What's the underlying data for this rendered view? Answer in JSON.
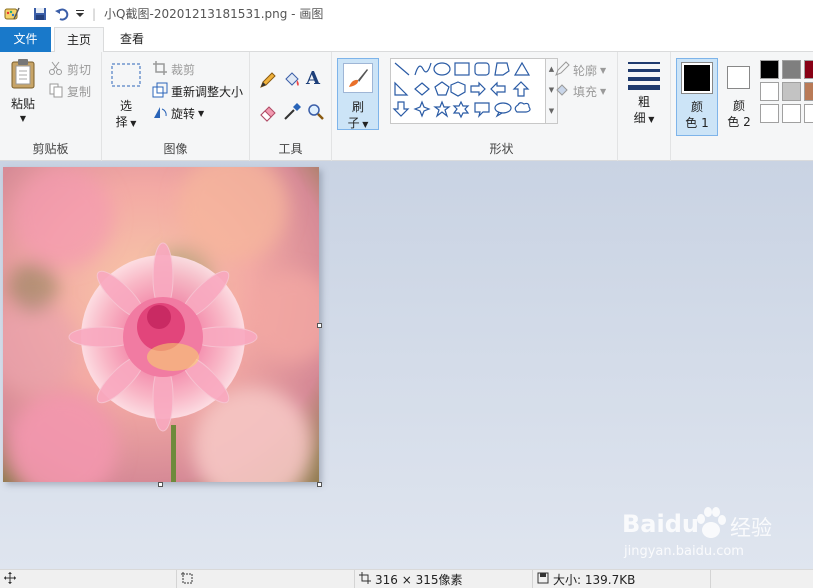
{
  "window": {
    "title": "小Q截图-20201213181531.png - 画图"
  },
  "tabs": [
    {
      "label": "文件"
    },
    {
      "label": "主页"
    },
    {
      "label": "查看"
    }
  ],
  "clipboard": {
    "paste": "粘贴",
    "cut": "剪切",
    "copy": "复制",
    "group": "剪贴板"
  },
  "image": {
    "select_1": "选",
    "select_2": "择",
    "crop": "裁剪",
    "resize": "重新调整大小",
    "rotate": "旋转",
    "group": "图像"
  },
  "tools": {
    "group": "工具"
  },
  "brushes": {
    "label_1": "刷",
    "label_2": "子"
  },
  "shapes": {
    "outline": "轮廓",
    "fill": "填充",
    "group": "形状"
  },
  "size": {
    "label_1": "粗",
    "label_2": "细"
  },
  "color1": {
    "label_1": "颜",
    "label_2": "色 1"
  },
  "color2": {
    "label_1": "颜",
    "label_2": "色 2"
  },
  "palette": [
    "#000000",
    "#7f7f7f",
    "#880015",
    "#ffffff",
    "#c3c3c3",
    "#b97a57",
    "#ffffff",
    "#ffffff",
    "#ffffff"
  ],
  "colors": {
    "accent": "#1979ca",
    "canvas_bg": "#c9d3e3",
    "selected_bg": "#cce4f7"
  },
  "status": {
    "dimensions": "316 × 315像素",
    "filesize": "大小: 139.7KB"
  },
  "watermark": {
    "brand": "Baidu",
    "cn": "经验",
    "url": "jingyan.baidu.com"
  }
}
